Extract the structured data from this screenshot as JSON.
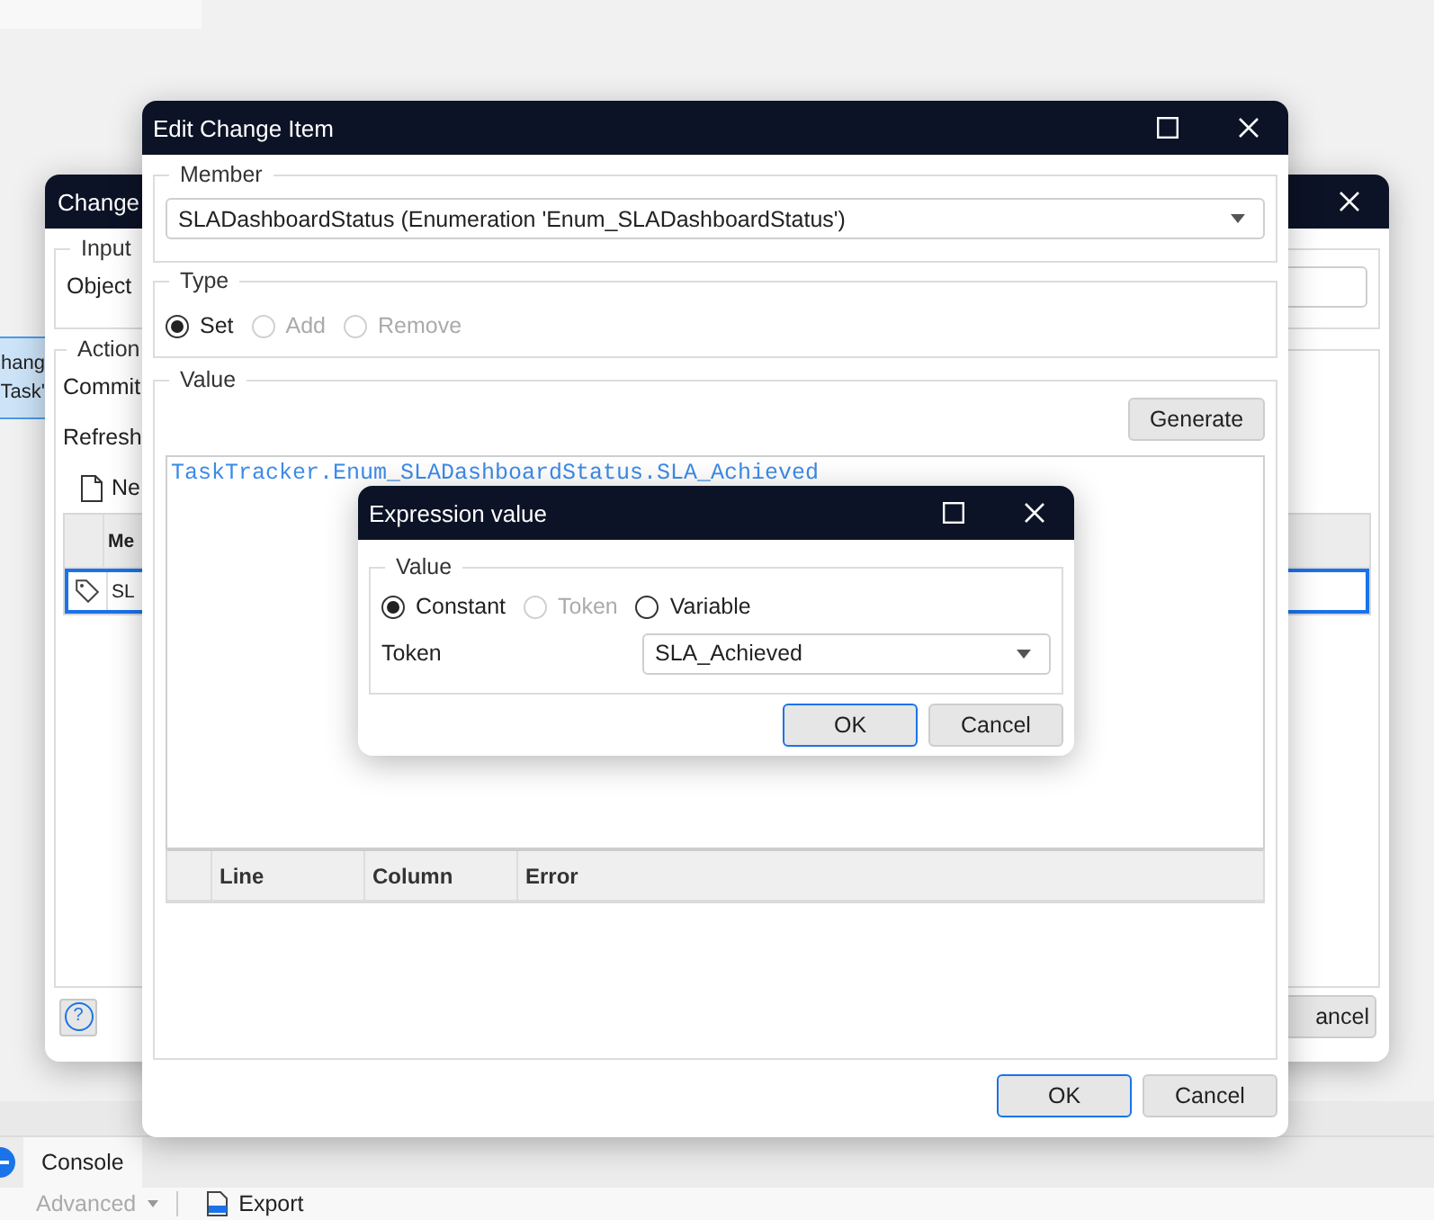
{
  "side_item": {
    "lines": [
      "hang",
      "Task'"
    ],
    "selected": true
  },
  "background_window": {
    "title": "Change",
    "input_group": {
      "label": "Input",
      "object_label": "Object"
    },
    "action_group": {
      "label": "Action",
      "commit_label": "Commit",
      "refresh_label": "Refresh",
      "new_button": "Ne",
      "grid_header": "Me",
      "rows": [
        {
          "text": "SL",
          "selected": true
        }
      ]
    },
    "help_button": "?",
    "cancel_button": "ancel"
  },
  "edit_window": {
    "title": "Edit Change Item",
    "member": {
      "label": "Member",
      "value": "SLADashboardStatus (Enumeration 'Enum_SLADashboardStatus')"
    },
    "type": {
      "label": "Type",
      "options": [
        {
          "label": "Set",
          "selected": true,
          "disabled": false
        },
        {
          "label": "Add",
          "selected": false,
          "disabled": true
        },
        {
          "label": "Remove",
          "selected": false,
          "disabled": true
        }
      ]
    },
    "value": {
      "label": "Value",
      "generate_button": "Generate",
      "expression": "TaskTracker.Enum_SLADashboardStatus.SLA_Achieved",
      "error_columns": [
        "Line",
        "Column",
        "Error"
      ]
    },
    "buttons": [
      {
        "label": "OK",
        "default": true
      },
      {
        "label": "Cancel",
        "default": false
      }
    ]
  },
  "expression_dialog": {
    "title": "Expression value",
    "group_label": "Value",
    "options": [
      {
        "label": "Constant",
        "selected": true,
        "disabled": false
      },
      {
        "label": "Token",
        "selected": false,
        "disabled": true
      },
      {
        "label": "Variable",
        "selected": false,
        "disabled": false
      }
    ],
    "token_label": "Token",
    "token_value": "SLA_Achieved",
    "buttons": [
      {
        "label": "OK",
        "default": true
      },
      {
        "label": "Cancel",
        "default": false
      }
    ]
  },
  "bottom_panel": {
    "tabs": [
      {
        "label": "Console",
        "selected": true
      }
    ],
    "toolbar": [
      {
        "kind": "dropdown",
        "label": "Advanced",
        "disabled": true
      },
      {
        "kind": "export",
        "label": "Export",
        "disabled": false
      }
    ]
  }
}
